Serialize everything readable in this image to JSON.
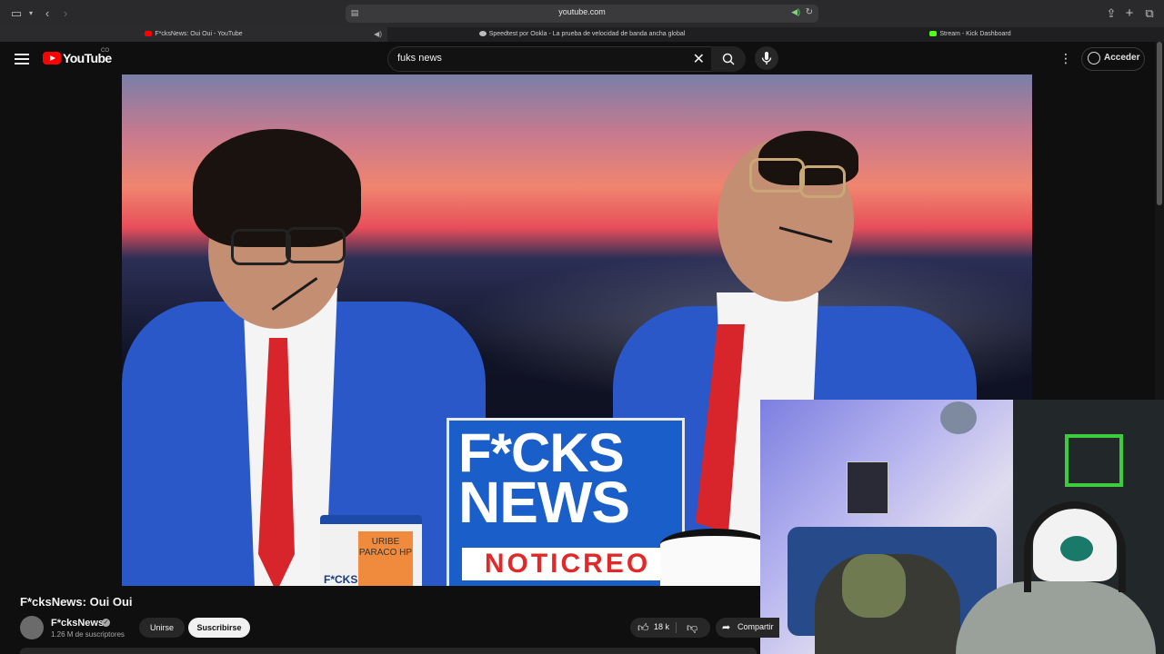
{
  "browser": {
    "url": "youtube.com",
    "tabs": [
      {
        "label": "F*cksNews: Oui Oui - YouTube",
        "favicon_color": "#ff0000",
        "active": true
      },
      {
        "label": "Speedtest por Ookla - La prueba de velocidad de banda ancha global",
        "favicon_color": "#bbbbbb",
        "active": false
      },
      {
        "label": "Stream - Kick Dashboard",
        "favicon_color": "#53fc18",
        "active": false
      }
    ]
  },
  "header": {
    "logo_text": "YouTube",
    "logo_country": "CO",
    "search_value": "fuks news",
    "signin_label": "Acceder"
  },
  "video": {
    "sign_line1": "F*CKS",
    "sign_line2": "NEWS",
    "sign_line3": "NOTICREO",
    "mug_note": "URIBE PARACO HP",
    "mug_brand": "F*CKS"
  },
  "meta": {
    "title": "F*cksNews: Oui Oui",
    "channel_name": "F*cksNews",
    "subscribers": "1.26 M de suscriptores",
    "join_label": "Unirse",
    "subscribe_label": "Suscribirse",
    "likes": "18 k",
    "share_label": "Compartir"
  },
  "colors": {
    "brand_red": "#ff0000",
    "suit_blue": "#2a58c8",
    "tie_red": "#d8242b",
    "kick_green": "#53fc18"
  }
}
